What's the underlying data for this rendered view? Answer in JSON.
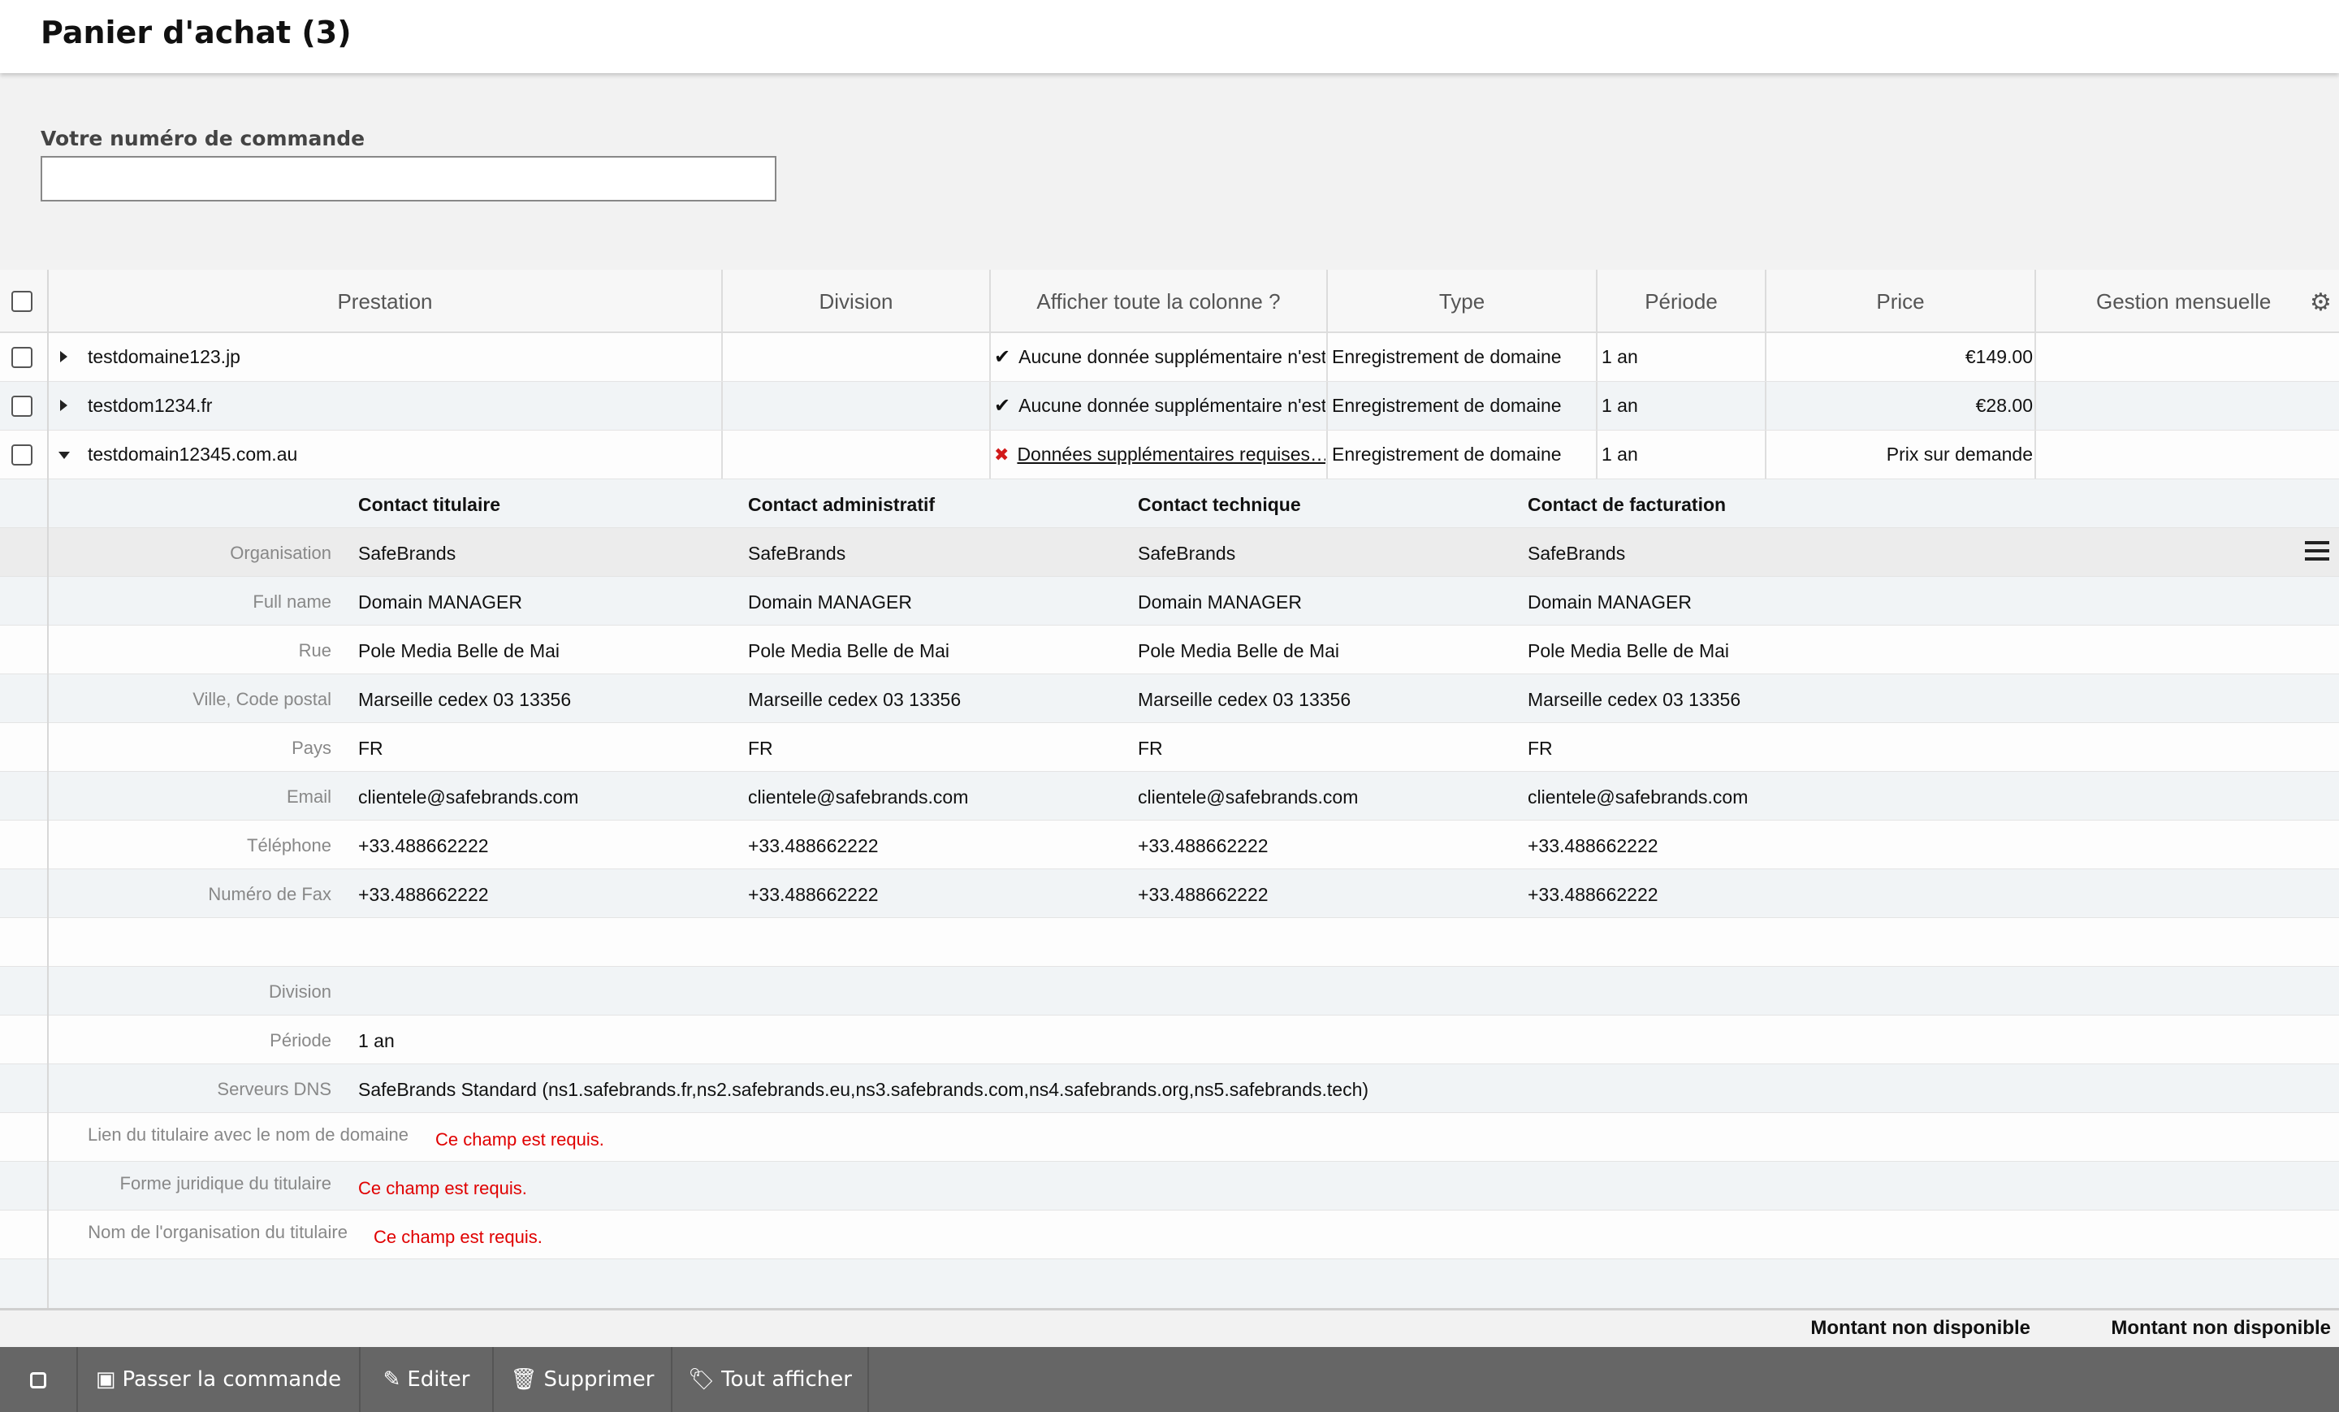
{
  "page": {
    "title": "Panier d'achat  (3)"
  },
  "order": {
    "label": "Votre numéro de commande",
    "value": ""
  },
  "table": {
    "columns": [
      "Prestation",
      "Division",
      "Afficher toute la colonne ?",
      "Type",
      "Période",
      "Price",
      "Gestion mensuelle"
    ],
    "rows": [
      {
        "name": "testdomaine123.jp",
        "extra": "Aucune donnée supplémentaire n'est requise",
        "type": "Enregistrement de domaine",
        "period": "1 an",
        "price": "€149.00"
      },
      {
        "name": "testdom1234.fr",
        "extra": "Aucune donnée supplémentaire n'est requise",
        "type": "Enregistrement de domaine",
        "period": "1 an",
        "price": "€28.00"
      },
      {
        "name": "testdomain12345.com.au",
        "extra": "Données supplémentaires requises…",
        "type": "Enregistrement de domaine",
        "period": "1 an",
        "price": "Prix sur demande"
      }
    ]
  },
  "details": {
    "contact_headers": [
      "Contact titulaire",
      "Contact administratif",
      "Contact technique",
      "Contact de facturation"
    ],
    "contact_rows": [
      {
        "label": "Organisation",
        "value": "SafeBrands"
      },
      {
        "label": "Full name",
        "value": "Domain MANAGER"
      },
      {
        "label": "Rue",
        "value": "Pole Media Belle de Mai"
      },
      {
        "label": "Ville, Code postal",
        "value": "Marseille cedex 03 13356"
      },
      {
        "label": "Pays",
        "value": "FR"
      },
      {
        "label": "Email",
        "value": "clientele@safebrands.com"
      },
      {
        "label": "Téléphone",
        "value": "+33.488662222"
      },
      {
        "label": "Numéro de Fax",
        "value": "+33.488662222"
      }
    ],
    "division_label": "Division",
    "division_value": "",
    "period_label": "Période",
    "period_value": "1 an",
    "dns_label": "Serveurs DNS",
    "dns_value": "SafeBrands Standard (ns1.safebrands.fr,ns2.safebrands.eu,ns3.safebrands.com,ns4.safebrands.org,ns5.safebrands.tech)",
    "required_fields": [
      {
        "label": "Lien du titulaire avec le nom de domaine",
        "error": "Ce champ est requis."
      },
      {
        "label": "Forme juridique du titulaire",
        "error": "Ce champ est requis."
      },
      {
        "label": "Nom de l'organisation du titulaire",
        "error": "Ce champ est requis."
      }
    ]
  },
  "totals": {
    "price_total": "Montant non disponible",
    "monthly_total": "Montant non disponible"
  },
  "toolbar": {
    "order_label": "Passer la commande",
    "edit_label": "Editer",
    "delete_label": "Supprimer",
    "show_all_label": "Tout afficher"
  }
}
